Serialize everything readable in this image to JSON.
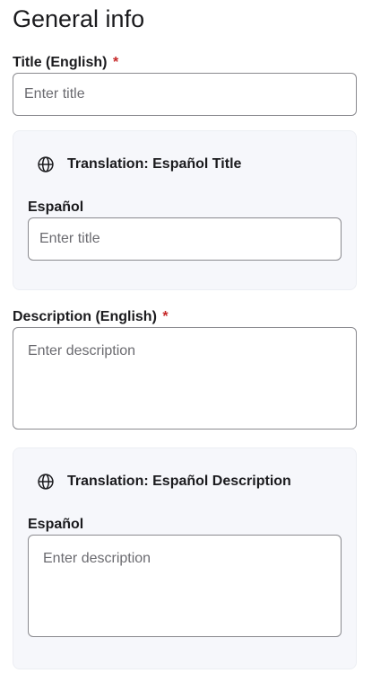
{
  "page": {
    "title": "General info"
  },
  "title_field": {
    "label": "Title (English)",
    "required_mark": "*",
    "value": "",
    "placeholder": "Enter title"
  },
  "title_translation": {
    "heading": "Translation: Español Title",
    "icon": "globe-icon",
    "label": "Español",
    "value": "",
    "placeholder": "Enter title"
  },
  "description_field": {
    "label": "Description (English)",
    "required_mark": "*",
    "value": "",
    "placeholder": "Enter description"
  },
  "description_translation": {
    "heading": "Translation: Español Description",
    "icon": "globe-icon",
    "label": "Español",
    "value": "",
    "placeholder": "Enter description"
  },
  "colors": {
    "required": "#c62828",
    "card_background": "#f6f7fb",
    "input_border": "#8a8a8f",
    "placeholder": "#6b6b70"
  }
}
